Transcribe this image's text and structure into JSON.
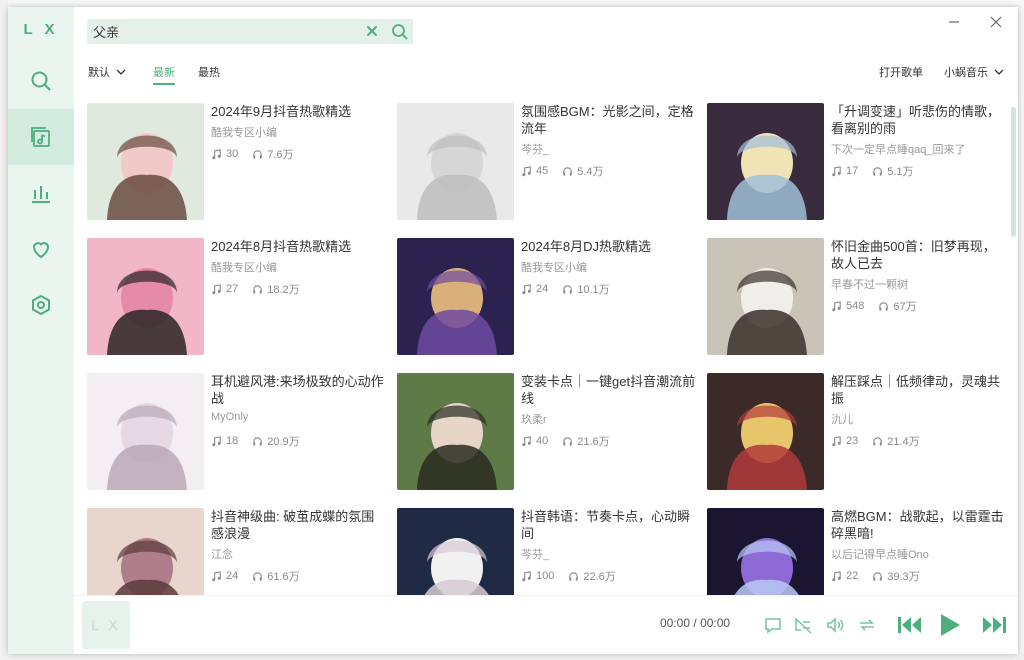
{
  "app": {
    "logo": "L X"
  },
  "search": {
    "value": "父亲",
    "placeholder": ""
  },
  "filters": {
    "sort_label": "默认",
    "tab_latest": "最新",
    "tab_hot": "最热",
    "open_playlist": "打开歌单",
    "source_label": "小蜗音乐"
  },
  "playlists": [
    {
      "title": "2024年9月抖音热歌精选",
      "author": "酷我专区小编",
      "songs": "30",
      "plays": "7.6万"
    },
    {
      "title": "氛围感BGM：光影之间，定格流年",
      "author": "芩芬_",
      "songs": "45",
      "plays": "5.4万"
    },
    {
      "title": "「升调变速」听悲伤的情歌，看离别的雨",
      "author": "下次一定早点睡qaq_回来了",
      "songs": "17",
      "plays": "5.1万"
    },
    {
      "title": "2024年8月抖音热歌精选",
      "author": "酷我专区小编",
      "songs": "27",
      "plays": "18.2万"
    },
    {
      "title": "2024年8月DJ热歌精选",
      "author": "酷我专区小编",
      "songs": "24",
      "plays": "10.1万"
    },
    {
      "title": "怀旧金曲500首：旧梦再现，故人已去",
      "author": "早春不过一颗树",
      "songs": "548",
      "plays": "67万"
    },
    {
      "title": "耳机避风港:来场极致的心动作战",
      "author": "MyOnly",
      "songs": "18",
      "plays": "20.9万"
    },
    {
      "title": "变装卡点｜一键get抖音潮流前线",
      "author": "玖柔r",
      "songs": "40",
      "plays": "21.6万"
    },
    {
      "title": "解压踩点｜低频律动，灵魂共振",
      "author": "氿儿",
      "songs": "23",
      "plays": "21.4万"
    },
    {
      "title": "抖音神级曲: 破茧成蝶的氛围感浪漫",
      "author": "江念",
      "songs": "24",
      "plays": "61.6万"
    },
    {
      "title": "抖音韩语：节奏卡点，心动瞬间",
      "author": "芩芬_",
      "songs": "100",
      "plays": "22.6万"
    },
    {
      "title": "高燃BGM：战歌起，以雷霆击碎黑暗!",
      "author": "以后记得早点睡Ono",
      "songs": "22",
      "plays": "39.3万"
    }
  ],
  "player": {
    "cover_text": "L X",
    "current_time": "00:00",
    "separator": "/",
    "total_time": "00:00"
  },
  "colors": {
    "accent": "#4caf7d",
    "sidebar_bg": "#eaf5ef",
    "search_bg": "#e3f1ea"
  }
}
